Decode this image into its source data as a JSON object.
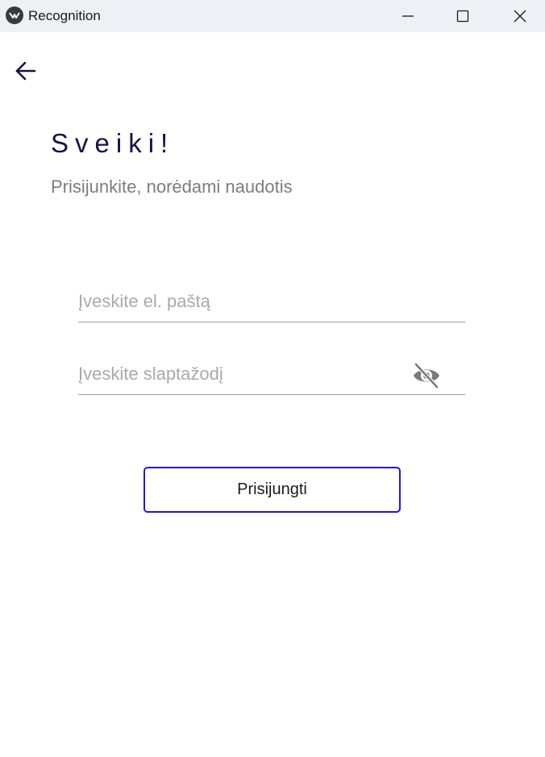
{
  "window": {
    "title": "Recognition",
    "icon": "app-logo-icon",
    "controls": [
      "minimize-icon",
      "maximize-icon",
      "close-icon"
    ]
  },
  "nav": {
    "back_icon": "arrow-left-icon"
  },
  "greeting": {
    "title": "Sveiki!",
    "subtitle": "Prisijunkite, norėdami naudotis"
  },
  "form": {
    "email": {
      "placeholder": "Įveskite el. paštą",
      "value": ""
    },
    "password": {
      "placeholder": "Įveskite slaptažodį",
      "value": "",
      "visibility_icon": "eye-off-icon"
    },
    "login_label": "Prisijungti"
  },
  "colors": {
    "titlebar_bg": "#eff0f6",
    "title_text": "#16124a",
    "subtitle_text": "#7d7d7d",
    "button_border": "#2b12d8"
  }
}
